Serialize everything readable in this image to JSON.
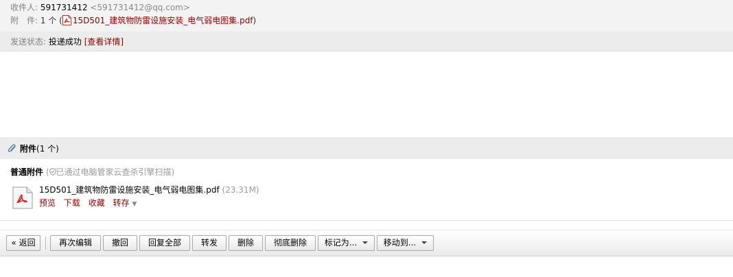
{
  "header": {
    "to_label": "收件人:",
    "to_name": "591731412",
    "to_email": "<591731412@qq.com>",
    "attach_label": "附　件:",
    "attach_count": "1 个",
    "attach_open": "(",
    "attach_file": "15D501_建筑物防雷设施安装_电气弱电图集.pdf",
    "attach_close": ")"
  },
  "status": {
    "label": "发送状态:",
    "value": "投递成功",
    "detail_link": "[查看详情]"
  },
  "attachments": {
    "title": "附件",
    "count": "(1 个)",
    "normal_label": "普通附件",
    "scan_open": "(",
    "scan_text": "已通过电脑管家云查杀引擎扫描",
    "scan_close": ")",
    "file_name": "15D501_建筑物防雷设施安装_电气弱电图集.pdf",
    "file_size": "(23.31M)",
    "actions": {
      "preview": "预览",
      "download": "下载",
      "collect": "收藏",
      "save_to": "转存"
    }
  },
  "toolbar": {
    "back": "« 返回",
    "edit_again": "再次编辑",
    "recall": "撤回",
    "reply_all": "回复全部",
    "forward": "转发",
    "delete": "删除",
    "delete_forever": "彻底删除",
    "mark_as": "标记为...",
    "move_to": "移动到..."
  },
  "icons": {
    "pdf": "pdf-file-icon",
    "clip": "paperclip-icon",
    "shield": "shield-icon",
    "dropdown": "chevron-down-icon"
  },
  "colors": {
    "link": "#8b0000",
    "header_bg": "#f3f3f3",
    "section_bg": "#ececec",
    "pdf_red": "#d9241c"
  }
}
